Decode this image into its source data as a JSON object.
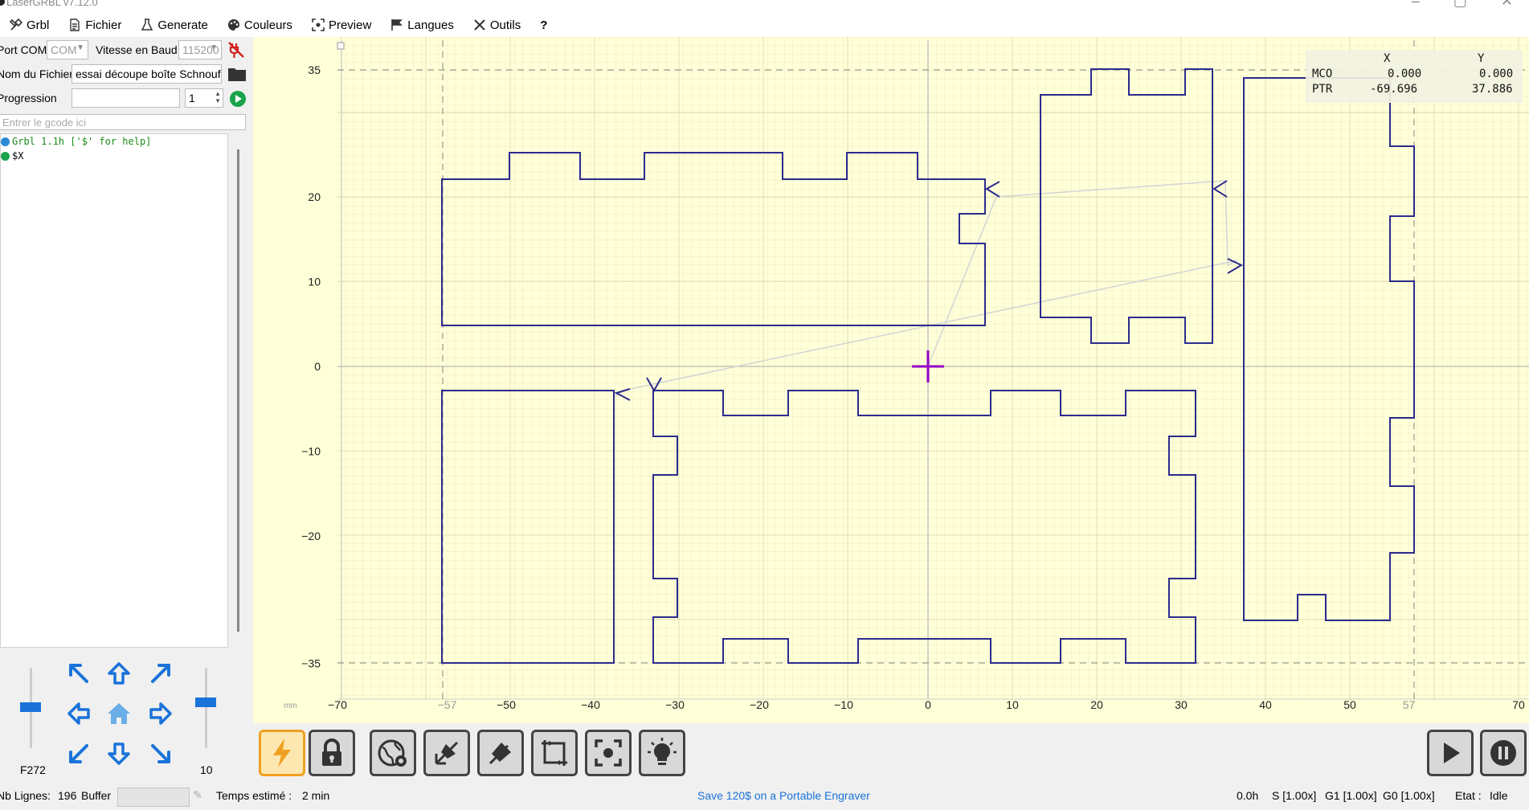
{
  "window": {
    "title": "LaserGRBL v7.12.0"
  },
  "menu": {
    "grbl": "Grbl",
    "fichier": "Fichier",
    "generate": "Generate",
    "couleurs": "Couleurs",
    "preview": "Preview",
    "langues": "Langues",
    "outils": "Outils",
    "help": "?"
  },
  "connection": {
    "port_label": "Port COM",
    "port_value": "COM",
    "baud_label": "Vitesse en Baud",
    "baud_value": "115200",
    "file_label": "Nom du Fichier",
    "file_value": "essai découpe boîte Schnoufy",
    "progress_label": "Progression",
    "progress_count": "1"
  },
  "console": {
    "placeholder": "Entrer le gcode ici",
    "lines": [
      {
        "text": "Grbl 1.1h ['$' for help]",
        "color": "#1a8a1a",
        "icon": "info-icon"
      },
      {
        "text": "$X",
        "color": "#1a1a1a",
        "icon": "check-icon"
      }
    ]
  },
  "jog": {
    "speed_label": "F272",
    "step_label": "10"
  },
  "plot": {
    "unit": "mm",
    "x_ticks": [
      "−70",
      "−57",
      "−50",
      "−40",
      "−30",
      "−20",
      "−10",
      "0",
      "10",
      "20",
      "30",
      "40",
      "50",
      "57",
      "70"
    ],
    "y_ticks": [
      "35",
      "20",
      "10",
      "0",
      "−10",
      "−20",
      "−35"
    ]
  },
  "coords": {
    "col_x": "X",
    "col_y": "Y",
    "mco_label": "MCO",
    "mco_x": "0.000",
    "mco_y": "0.000",
    "ptr_label": "PTR",
    "ptr_x": "-69.696",
    "ptr_y": "37.886"
  },
  "status": {
    "lines_label": "Nb Lignes:",
    "lines_value": "196",
    "buffer_label": "Buffer",
    "time_label": "Temps estimé :",
    "time_value": "2 min",
    "promo": "Save 120$ on a Portable Engraver",
    "elapsed": "0.0h",
    "s_override": "S [1.00x]",
    "g1_override": "G1 [1.00x]",
    "g0_override": "G0 [1.00x]",
    "state_label": "Etat :",
    "state_value": "Idle"
  },
  "colors": {
    "accent": "#1a73d9",
    "canvas_bg": "#ffffd8",
    "toolpath": "#2b2b8e",
    "cursor": "#9400c8",
    "promo_link": "#1a73d9"
  }
}
